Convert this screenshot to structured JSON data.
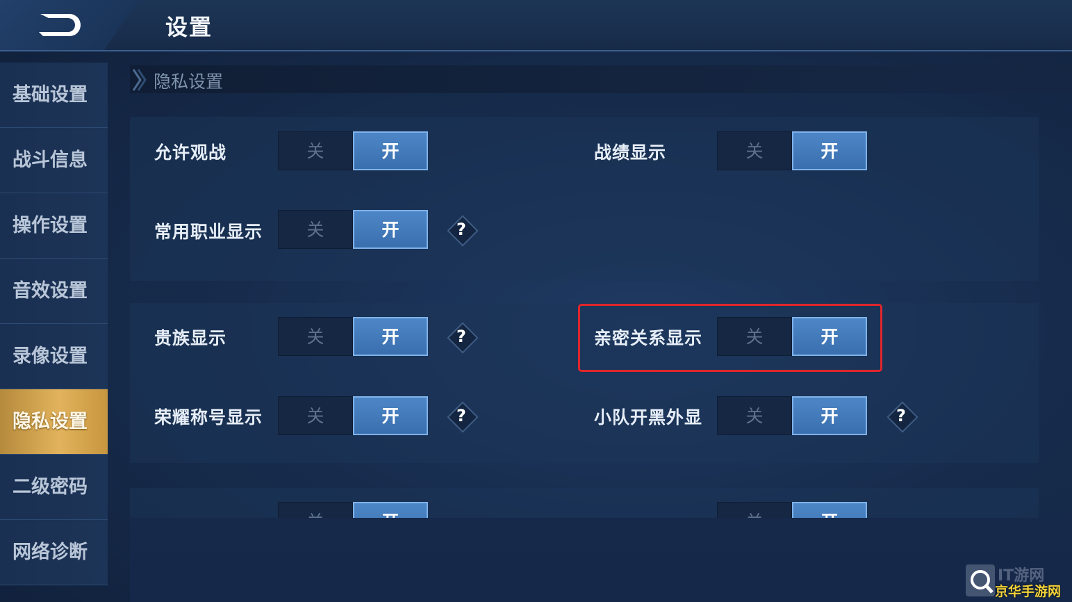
{
  "header": {
    "title": "设置"
  },
  "sidebar": {
    "items": [
      {
        "label": "基础设置"
      },
      {
        "label": "战斗信息"
      },
      {
        "label": "操作设置"
      },
      {
        "label": "音效设置"
      },
      {
        "label": "录像设置"
      },
      {
        "label": "隐私设置"
      },
      {
        "label": "二级密码"
      },
      {
        "label": "网络诊断"
      }
    ],
    "active_index": 5
  },
  "section": {
    "title": "隐私设置"
  },
  "toggle_labels": {
    "off": "关",
    "on": "开"
  },
  "settings": [
    {
      "label": "允许观战",
      "state": "开",
      "help": false
    },
    {
      "label": "战绩显示",
      "state": "开",
      "help": false
    },
    {
      "label": "常用职业显示",
      "state": "开",
      "help": true
    },
    {
      "label": "贵族显示",
      "state": "开",
      "help": true
    },
    {
      "label": "亲密关系显示",
      "state": "开",
      "help": false
    },
    {
      "label": "荣耀称号显示",
      "state": "开",
      "help": true
    },
    {
      "label": "小队开黑外显",
      "state": "开",
      "help": true
    }
  ],
  "help_symbol": "?",
  "watermark": {
    "top": "IT游网",
    "bottom": "京华手游网"
  },
  "colors": {
    "active_tab": "#e2b35c",
    "toggle_on": "#4d86c7",
    "highlight": "#e0262b"
  }
}
